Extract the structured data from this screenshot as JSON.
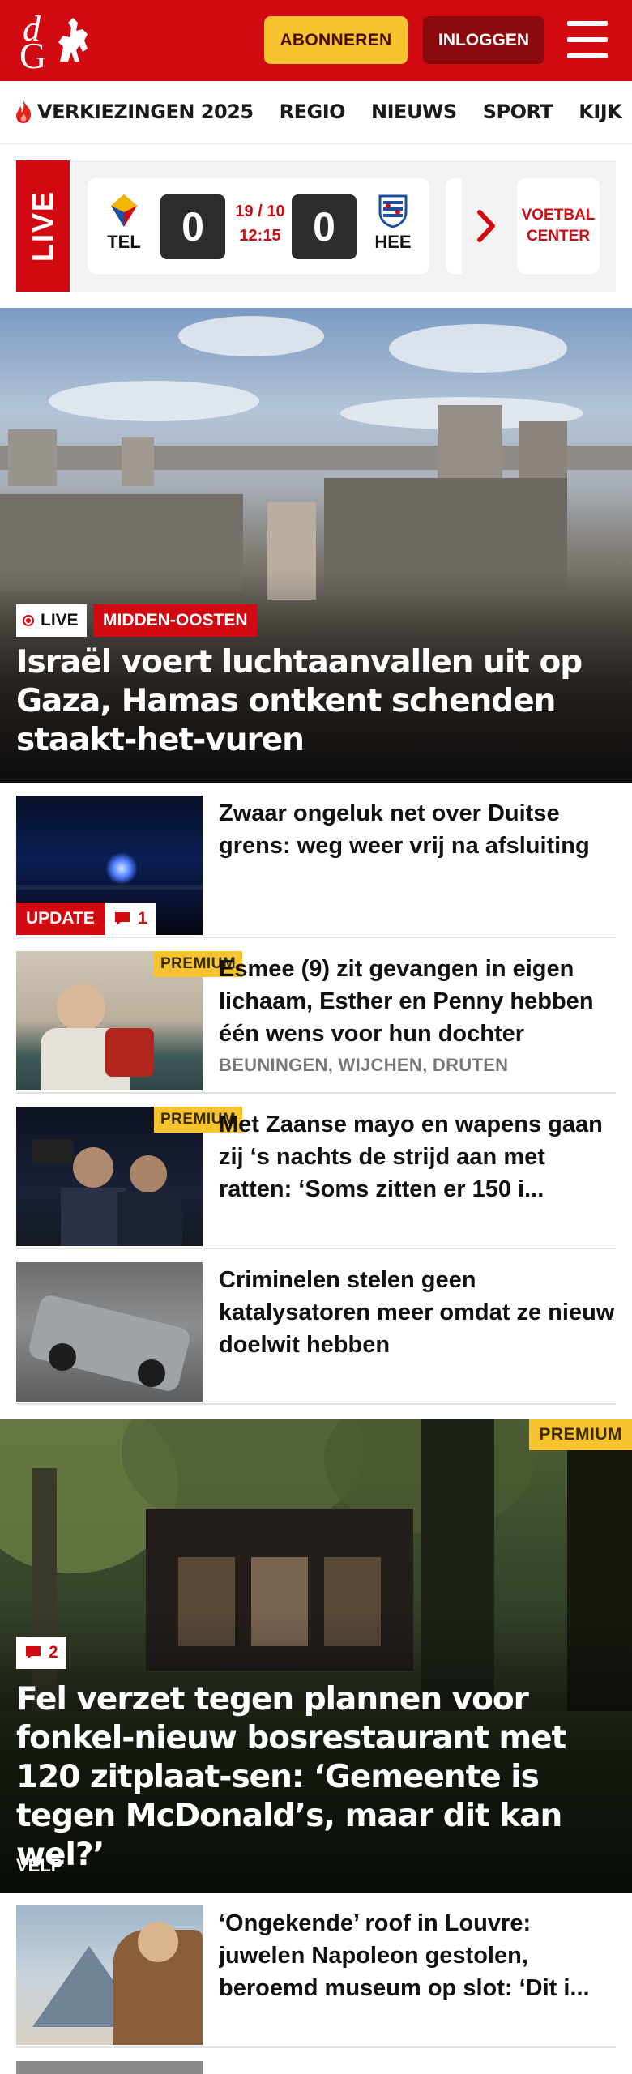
{
  "header": {
    "logo_letters": "dG",
    "subscribe_label": "ABONNEREN",
    "login_label": "INLOGGEN",
    "colors": {
      "brand_red": "#d10a11",
      "subscribe_yellow": "#f7c32e",
      "login_dark_red": "#8c0a0e"
    }
  },
  "nav": {
    "items": [
      {
        "label": "VERKIEZINGEN 2025",
        "icon": "flame-icon"
      },
      {
        "label": "REGIO"
      },
      {
        "label": "NIEUWS"
      },
      {
        "label": "SPORT"
      },
      {
        "label": "KIJK"
      }
    ]
  },
  "live": {
    "label": "LIVE",
    "match": {
      "home_abbr": "TEL",
      "away_abbr": "HEE",
      "home_score": "0",
      "away_score": "0",
      "date": "19 / 10",
      "time": "12:15"
    },
    "voetbal_center_line1": "VOETBAL",
    "voetbal_center_line2": "CENTER"
  },
  "hero": {
    "live_badge": "LIVE",
    "category": "MIDDEN-OOSTEN",
    "title": "Israël voert luchtaanvallen uit op Gaza, Hamas ontkent schenden staakt-het-vuren"
  },
  "articles": [
    {
      "title": "Zwaar ongeluk net over Duitse grens: weg weer vrij na afsluiting",
      "update_badge": "UPDATE",
      "comments": "1"
    },
    {
      "title": "Esmee (9) zit gevangen in eigen lichaam, Esther en Penny hebben één wens voor hun dochter",
      "premium": "PREMIUM",
      "meta": "BEUNINGEN, WIJCHEN, DRUTEN"
    },
    {
      "title": "Met Zaanse mayo en wapens gaan zij ‘s nachts de strijd aan met ratten: ‘Soms zitten er 150 i...",
      "premium": "PREMIUM"
    },
    {
      "title": "Criminelen stelen geen katalysatoren meer omdat ze nieuw doelwit hebben"
    }
  ],
  "feature": {
    "premium": "PREMIUM",
    "comments": "2",
    "title": "Fel verzet tegen plannen voor fonkel-nieuw bosrestaurant met 120 zitplaat-sen: ‘Gemeente is tegen McDonald’s, maar dit kan wel?’",
    "location": "VELP"
  },
  "more_articles": [
    {
      "title": "‘Ongekende’ roof in Louvre: juwelen Napoleon gestolen, beroemd museum op slot: ‘Dit i..."
    }
  ]
}
